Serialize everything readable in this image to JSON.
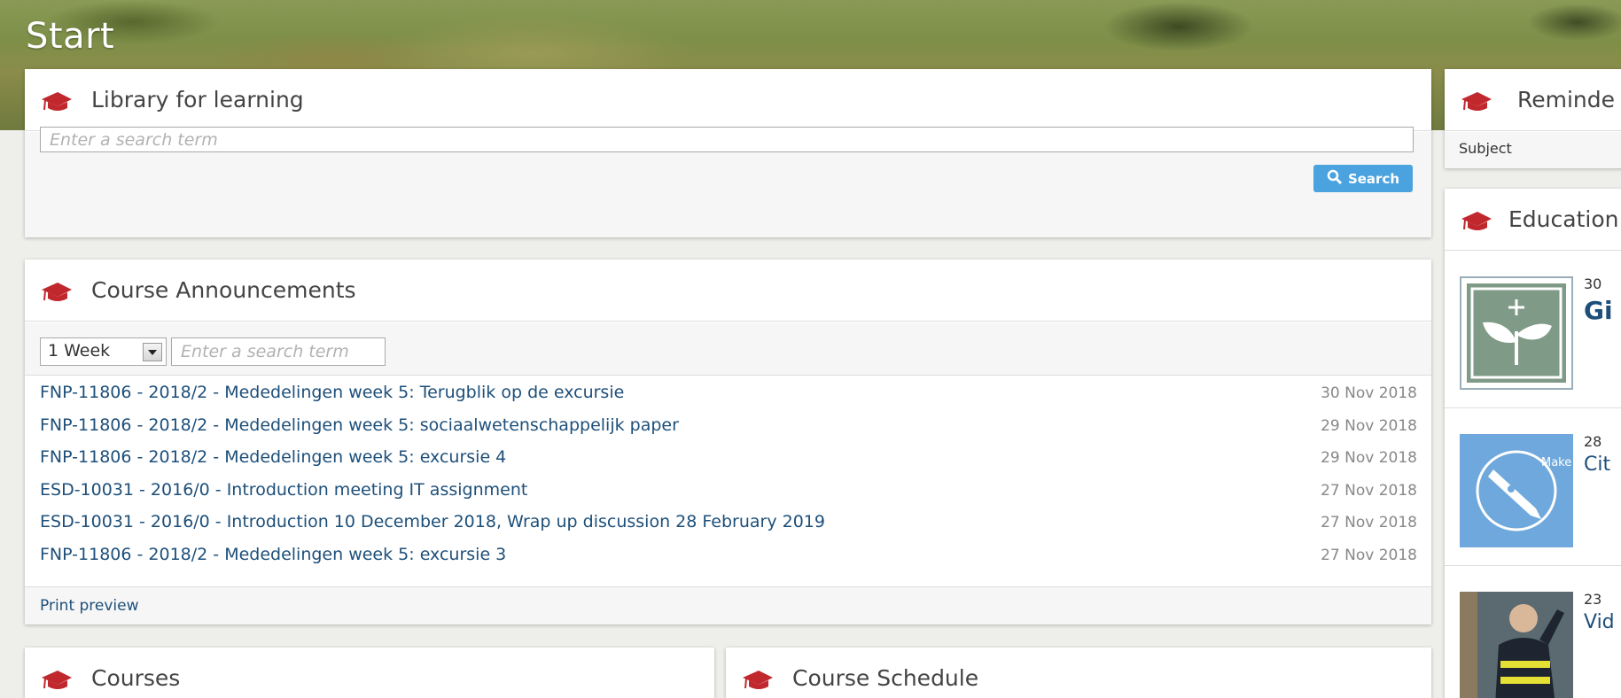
{
  "page": {
    "title": "Start"
  },
  "library": {
    "title": "Library for learning",
    "search_placeholder": "Enter a search term",
    "search_button": "Search"
  },
  "announcements": {
    "title": "Course Announcements",
    "period_value": "1 Week",
    "search_placeholder": "Enter a search term",
    "items": [
      {
        "title": "FNP-11806 - 2018/2 - Mededelingen week 5: Terugblik op de excursie",
        "date": "30 Nov 2018"
      },
      {
        "title": "FNP-11806 - 2018/2 - Mededelingen week 5: sociaalwetenschappelijk paper",
        "date": "29 Nov 2018"
      },
      {
        "title": "FNP-11806 - 2018/2 - Mededelingen week 5: excursie 4",
        "date": "29 Nov 2018"
      },
      {
        "title": "ESD-10031 - 2016/0 - Introduction meeting IT assignment",
        "date": "27 Nov 2018"
      },
      {
        "title": "ESD-10031 - 2016/0 - Introduction 10 December 2018, Wrap up discussion 28 February 2019",
        "date": "27 Nov 2018"
      },
      {
        "title": "FNP-11806 - 2018/2 - Mededelingen week 5: excursie 3",
        "date": "27 Nov 2018"
      }
    ],
    "print_preview": "Print preview"
  },
  "courses": {
    "title": "Courses"
  },
  "schedule": {
    "title": "Course Schedule"
  },
  "reminders": {
    "title": "Reminde",
    "subject_label": "Subject"
  },
  "education": {
    "title": "Education",
    "items": [
      {
        "day": "30",
        "text": "Gi"
      },
      {
        "day": "28",
        "text": "Cit",
        "thumb_text": "Make your writing work"
      },
      {
        "day": "23",
        "text": "Vid"
      }
    ]
  },
  "colors": {
    "accent_red": "#c0282d",
    "link_blue": "#1d4f7a",
    "button_blue": "#4aa3df",
    "thumb_blue": "#6fa8dc",
    "thumb_green": "#7f9a86"
  },
  "icons": {
    "panel_icon": "graduation-cap-icon",
    "search_button_icon": "magnifier-icon"
  }
}
